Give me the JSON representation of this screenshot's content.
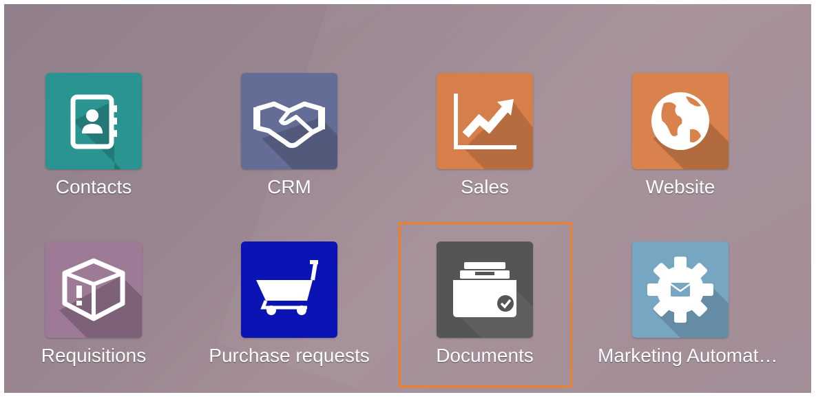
{
  "apps": [
    {
      "name": "Contacts",
      "icon": "contacts-icon",
      "color": "#2a9490"
    },
    {
      "name": "CRM",
      "icon": "handshake-icon",
      "color": "#646d96"
    },
    {
      "name": "Sales",
      "icon": "chart-line-icon",
      "color": "#d77f4b"
    },
    {
      "name": "Website",
      "icon": "globe-icon",
      "color": "#d9824d"
    },
    {
      "name": "Requisitions",
      "icon": "box-exclamation-icon",
      "color": "#9d7a96"
    },
    {
      "name": "Purchase requests",
      "icon": "shopping-cart-icon",
      "color": "#0a14b4"
    },
    {
      "name": "Documents",
      "icon": "document-drawer-icon",
      "color": "#555555"
    },
    {
      "name": "Marketing Automat…",
      "icon": "gear-envelope-icon",
      "color": "#76a6c2"
    }
  ],
  "highlight_color": "#f07e26"
}
